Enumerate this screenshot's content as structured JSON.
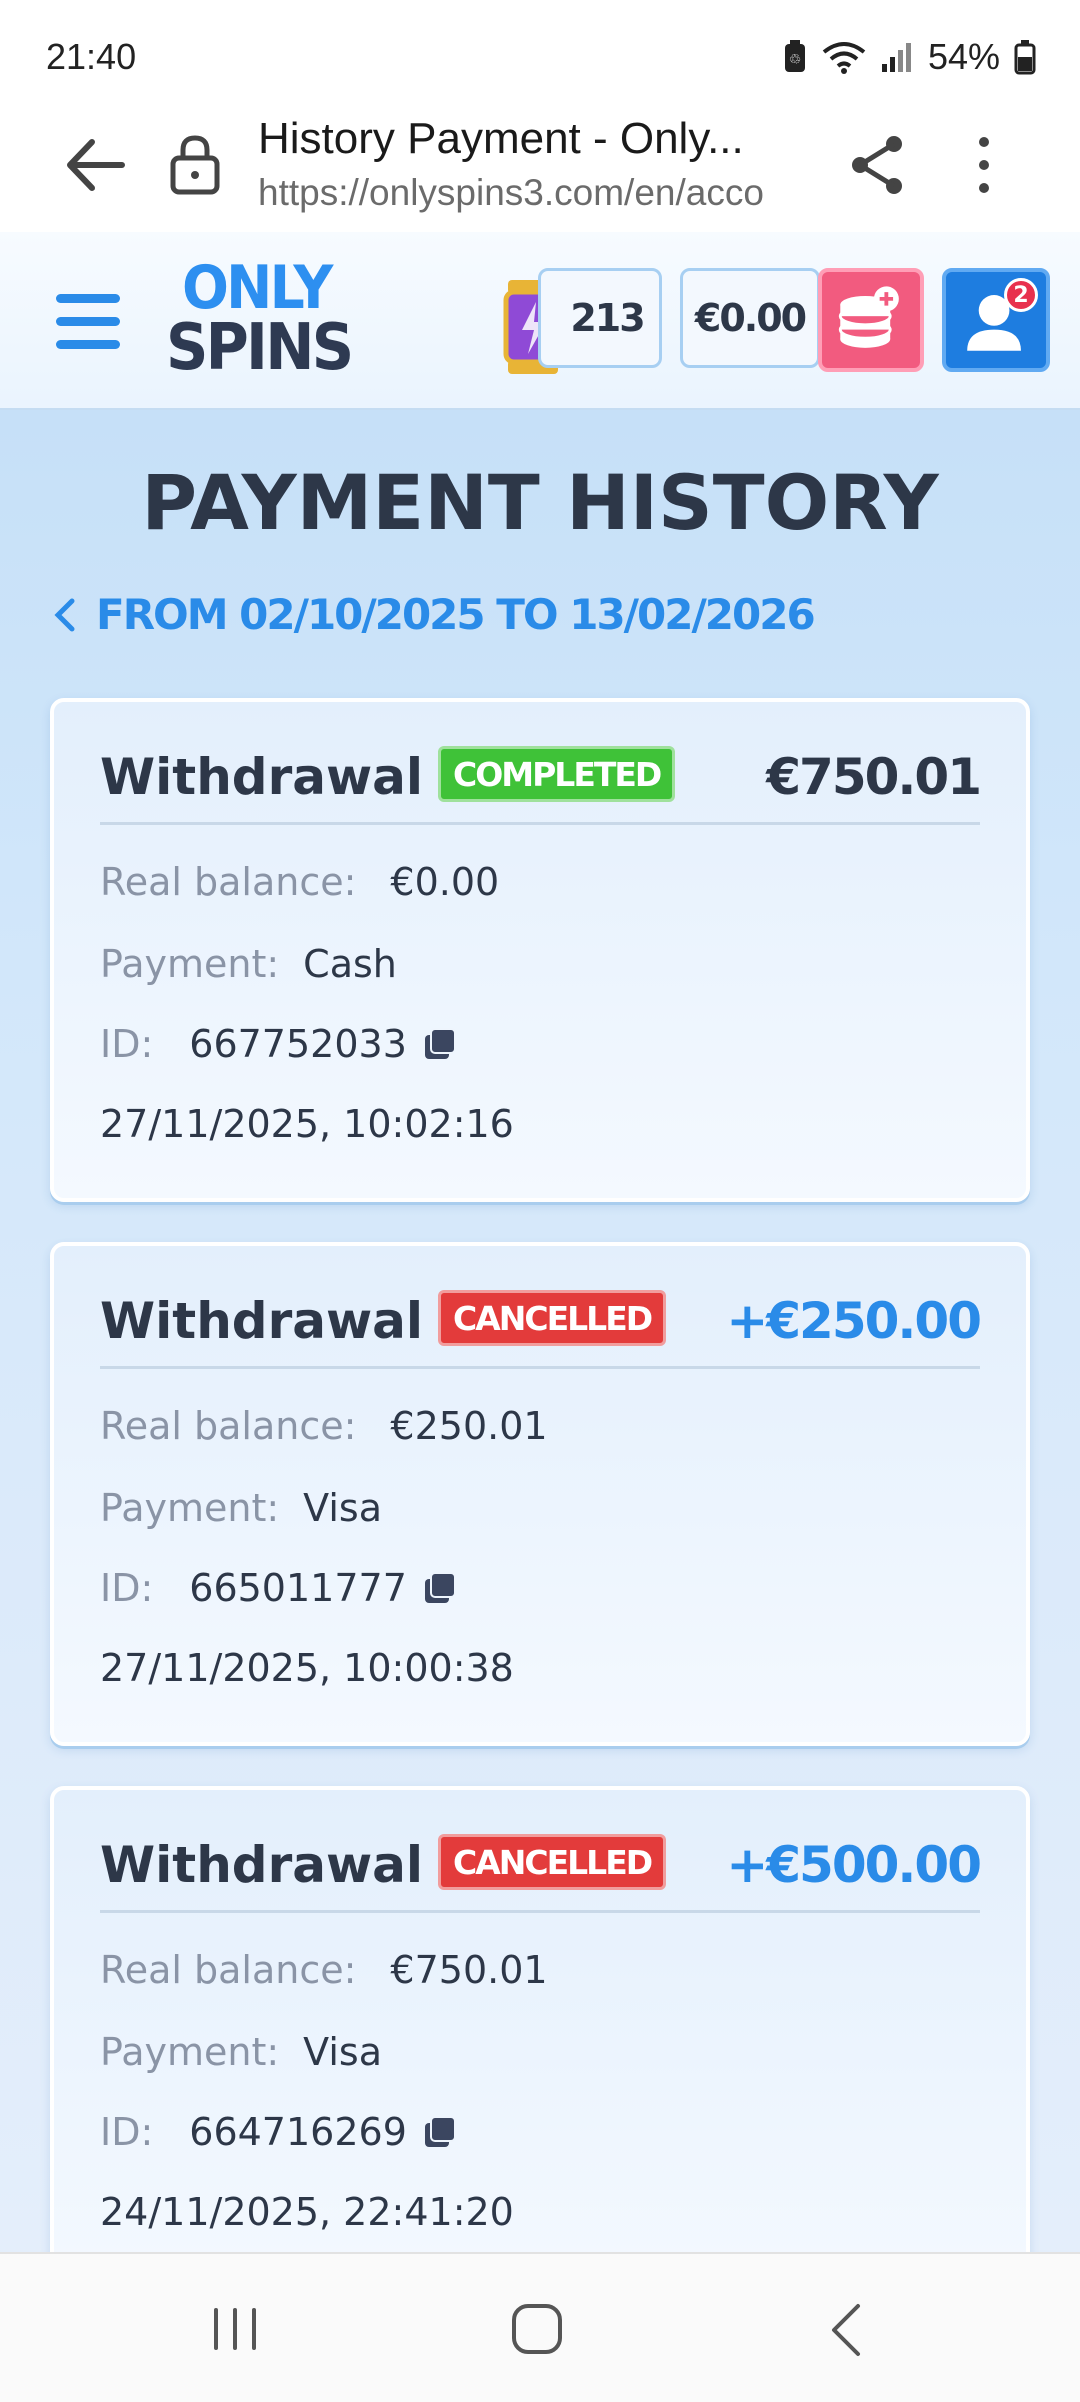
{
  "status_bar": {
    "time": "21:40",
    "battery": "54%"
  },
  "browser": {
    "title": "History Payment - Only...",
    "url": "https://onlyspins3.com/en/acco"
  },
  "site_header": {
    "logo_line1": "ONLY",
    "logo_line2": "SPINS",
    "spins_count": "213",
    "balance": "€0.00",
    "notifications": "2"
  },
  "page": {
    "title": "PAYMENT HISTORY",
    "date_range": "FROM 02/10/2025 TO 13/02/2026"
  },
  "labels": {
    "real_balance": "Real balance:",
    "payment": "Payment:",
    "id": "ID:"
  },
  "transactions": [
    {
      "type": "Withdrawal",
      "status": "COMPLETED",
      "amount": "€750.01",
      "real_balance": "€0.00",
      "payment": "Cash",
      "id": "667752033",
      "datetime": "27/11/2025, 10:02:16"
    },
    {
      "type": "Withdrawal",
      "status": "CANCELLED",
      "amount": "+€250.00",
      "real_balance": "€250.01",
      "payment": "Visa",
      "id": "665011777",
      "datetime": "27/11/2025, 10:00:38"
    },
    {
      "type": "Withdrawal",
      "status": "CANCELLED",
      "amount": "+€500.00",
      "real_balance": "€750.01",
      "payment": "Visa",
      "id": "664716269",
      "datetime": "24/11/2025, 22:41:20"
    }
  ],
  "colors": {
    "accent": "#2a8be8",
    "completed": "#3fc238",
    "cancelled": "#e33b3b",
    "text": "#2d3748",
    "muted": "#8a94a6"
  }
}
